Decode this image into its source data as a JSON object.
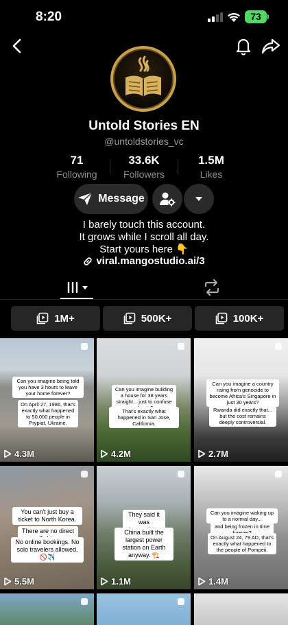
{
  "status": {
    "time": "8:20",
    "battery": "73"
  },
  "profile": {
    "display_name": "Untold Stories EN",
    "username": "@untoldstories_vc",
    "stats": [
      {
        "value": "71",
        "label": "Following"
      },
      {
        "value": "33.6K",
        "label": "Followers"
      },
      {
        "value": "1.5M",
        "label": "Likes"
      }
    ],
    "message_label": "Message",
    "bio": [
      "I barely touch this account.",
      "It grows while I scroll all day.",
      "Start yours here 👇"
    ],
    "link": "viral.mangostudio.ai/3"
  },
  "filters": [
    "1M+",
    "500K+",
    "100K+"
  ],
  "videos": [
    {
      "views": "4.3M",
      "captions": [
        "Can you imagine being told you have 3 hours to leave your home forever?",
        "On April 27, 1986, that's exactly what happened to 50,000 people in Prypiat, Ukraine."
      ]
    },
    {
      "views": "4.2M",
      "captions": [
        "Can you imagine building a house for 38 years straight... just to confuse ghosts?",
        "That's exactly what happened in San Jose, California."
      ]
    },
    {
      "views": "2.7M",
      "captions": [
        "Can you imagine a country rising from genocide to become Africa's Singapore in just 30 years?",
        "Rwanda did exactly that... but the cost remains deeply controversial."
      ]
    },
    {
      "views": "5.5M",
      "captions": [
        "You can't just buy a ticket to North Korea.",
        "There are no direct flights.",
        "No online bookings. No solo travelers allowed. 🚫✈️"
      ]
    },
    {
      "views": "1.1M",
      "captions": [
        "They said it was impossible.",
        "China built the largest power station on Earth anyway. 🏗️"
      ]
    },
    {
      "views": "1.4M",
      "captions": [
        "Can you imagine waking up to a normal day...",
        "and being frozen in time forever?",
        "On August 24, 79 AD, that's exactly what happened to the people of Pompeii."
      ]
    }
  ]
}
